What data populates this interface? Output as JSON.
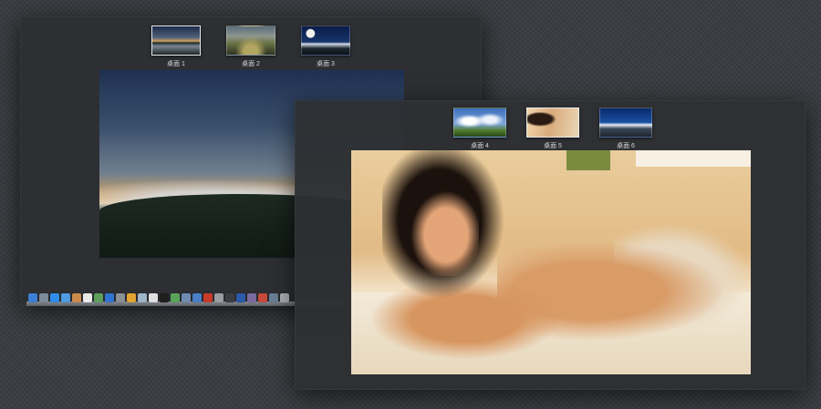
{
  "spaces_a": {
    "desktops": [
      {
        "label": "桌面 1",
        "active": true
      },
      {
        "label": "桌面 2",
        "active": false
      },
      {
        "label": "桌面 3",
        "active": false
      }
    ]
  },
  "spaces_b": {
    "desktops": [
      {
        "label": "桌面 4",
        "active": false
      },
      {
        "label": "桌面 5",
        "active": true
      },
      {
        "label": "桌面 6",
        "active": false
      }
    ]
  },
  "dock": {
    "icons": [
      {
        "name": "finder-icon",
        "color": "#3d7fd6"
      },
      {
        "name": "launchpad-icon",
        "color": "#7d8a9a"
      },
      {
        "name": "safari-icon",
        "color": "#2f8ce8"
      },
      {
        "name": "mail-icon",
        "color": "#4e9ce0"
      },
      {
        "name": "contacts-icon",
        "color": "#c98a4a"
      },
      {
        "name": "calendar-icon",
        "color": "#e9e9e9"
      },
      {
        "name": "photos-icon",
        "color": "#5c9e5a"
      },
      {
        "name": "app-store-icon",
        "color": "#2f74d0"
      },
      {
        "name": "system-preferences-icon",
        "color": "#8b8f96"
      },
      {
        "name": "chrome-icon",
        "color": "#e2a331"
      },
      {
        "name": "preview-icon",
        "color": "#9fb5c8"
      },
      {
        "name": "textedit-icon",
        "color": "#dfdfdf"
      },
      {
        "name": "terminal-icon",
        "color": "#1e1e1e"
      },
      {
        "name": "activity-monitor-icon",
        "color": "#5aa35a"
      },
      {
        "name": "network-icon",
        "color": "#6f8bb0"
      },
      {
        "name": "xcode-icon",
        "color": "#4a7fc5"
      },
      {
        "name": "filezilla-icon",
        "color": "#c73b2a"
      },
      {
        "name": "utility-icon",
        "color": "#9a9da3"
      },
      {
        "name": "console-icon",
        "color": "#3a3d42"
      },
      {
        "name": "word-icon",
        "color": "#2a5aa8"
      },
      {
        "name": "app-icon",
        "color": "#7a6a9e"
      },
      {
        "name": "parallels-icon",
        "color": "#c84a3a"
      },
      {
        "name": "downloads-icon",
        "color": "#6a7e96"
      },
      {
        "name": "trash-icon",
        "color": "#aeb2b8"
      }
    ]
  }
}
